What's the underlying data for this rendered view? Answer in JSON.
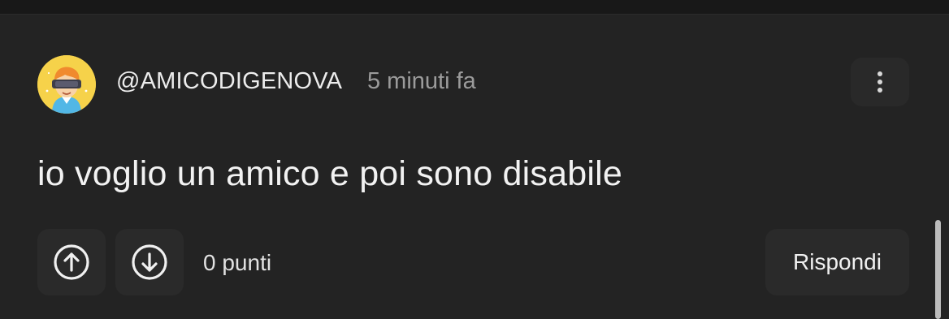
{
  "comment": {
    "username": "@AMICODIGENOVA",
    "timestamp": "5 minuti fa",
    "text": "io voglio un amico e poi sono disabile",
    "score_label": "0 punti",
    "reply_label": "Rispondi"
  },
  "icons": {
    "more": "more-vertical-icon",
    "upvote": "arrow-up-circle-icon",
    "downvote": "arrow-down-circle-icon"
  },
  "colors": {
    "background": "#232323",
    "button_bg": "#2a2a2a",
    "avatar_bg": "#f6d24a",
    "text_primary": "#f2f2f2",
    "text_muted": "#9b9b9b"
  }
}
